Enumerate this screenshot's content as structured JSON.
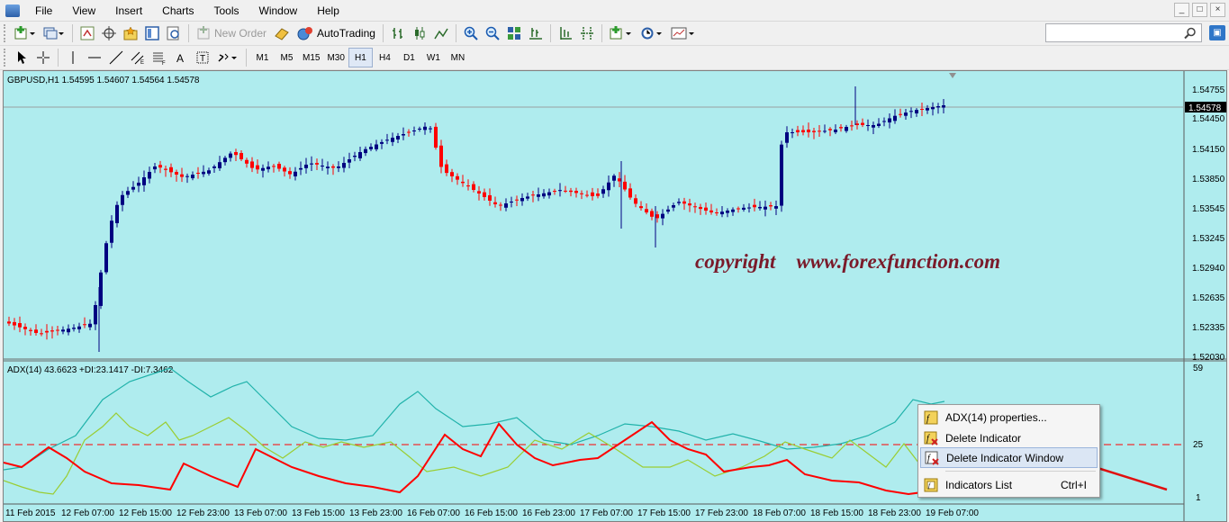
{
  "menubar": {
    "items": [
      "File",
      "View",
      "Insert",
      "Charts",
      "Tools",
      "Window",
      "Help"
    ]
  },
  "toolbar": {
    "new_order_label": "New Order",
    "autotrading_label": "AutoTrading",
    "timeframes": [
      "M1",
      "M5",
      "M15",
      "M30",
      "H1",
      "H4",
      "D1",
      "W1",
      "MN"
    ],
    "active_timeframe": "H1"
  },
  "chart": {
    "header": "GBPUSD,H1  1.54595 1.54607 1.54564 1.54578",
    "current_price": "1.54578",
    "watermark": "copyright    www.forexfunction.com",
    "price_ticks": [
      "1.54755",
      "1.54450",
      "1.54150",
      "1.53850",
      "1.53545",
      "1.53245",
      "1.52940",
      "1.52635",
      "1.52335",
      "1.52030"
    ],
    "date_labels": [
      "11 Feb 2015",
      "12 Feb 07:00",
      "12 Feb 15:00",
      "12 Feb 23:00",
      "13 Feb 07:00",
      "13 Feb 15:00",
      "13 Feb 23:00",
      "16 Feb 07:00",
      "16 Feb 15:00",
      "16 Feb 23:00",
      "17 Feb 07:00",
      "17 Feb 15:00",
      "17 Feb 23:00",
      "18 Feb 07:00",
      "18 Feb 15:00",
      "18 Feb 23:00",
      "19 Feb 07:00"
    ],
    "colors": {
      "background": "#afecee",
      "bull": "#000080",
      "bear": "#ff0000",
      "adx_line": "#20b2aa",
      "plus_di": "#9acd32",
      "minus_di": "#ff0000",
      "level_line": "#ff0000"
    }
  },
  "indicator": {
    "header": "ADX(14) 43.6623 +DI:23.1417 -DI:7.3462",
    "scale_ticks": [
      "59",
      "25",
      "1"
    ]
  },
  "context_menu": {
    "items": [
      {
        "label": "ADX(14) properties...",
        "icon": "indicator-properties-icon",
        "shortcut": ""
      },
      {
        "label": "Delete Indicator",
        "icon": "delete-indicator-icon",
        "shortcut": ""
      },
      {
        "label": "Delete Indicator Window",
        "icon": "delete-window-icon",
        "shortcut": ""
      },
      {
        "label": "Indicators List",
        "icon": "indicators-list-icon",
        "shortcut": "Ctrl+I"
      }
    ],
    "highlighted": "Delete Indicator Window"
  }
}
